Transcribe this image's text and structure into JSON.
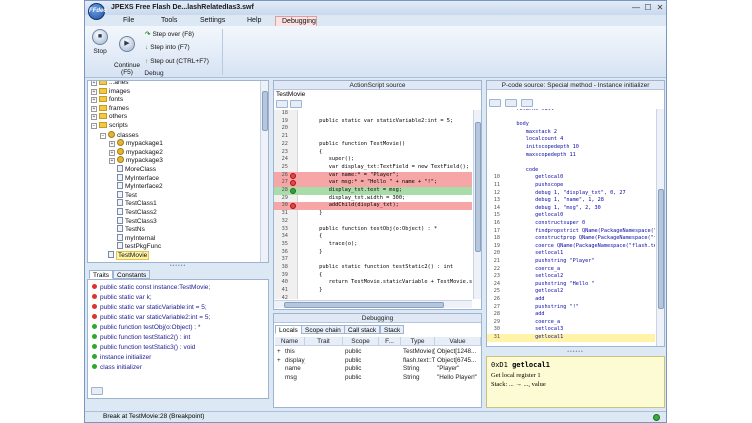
{
  "window": {
    "logo": "FFdec",
    "title": "JPEXS Free Flash De...lashRelatedIas3.swf",
    "controls": {
      "minimize": "—",
      "maximize": "☐",
      "close": "✕"
    }
  },
  "menu": [
    "File",
    "Tools",
    "Settings",
    "Help",
    "Debugging"
  ],
  "ribbon": {
    "stop_label": "Stop",
    "continue_label": "Continue\n(F5)",
    "step_over": "Step over (F8)",
    "step_into": "Step into (F7)",
    "step_out": "Step out (CTRL+F7)",
    "group_label": "Debug"
  },
  "tree": {
    "items": [
      {
        "label": "...aries",
        "indent": 0,
        "kind": "folder",
        "expander": "+"
      },
      {
        "label": "images",
        "indent": 0,
        "kind": "folder",
        "expander": "+"
      },
      {
        "label": "fonts",
        "indent": 0,
        "kind": "folder",
        "expander": "+"
      },
      {
        "label": "frames",
        "indent": 0,
        "kind": "folder",
        "expander": "+"
      },
      {
        "label": "others",
        "indent": 0,
        "kind": "folder",
        "expander": "+"
      },
      {
        "label": "scripts",
        "indent": 0,
        "kind": "folder",
        "expander": "−"
      },
      {
        "label": "classes",
        "indent": 1,
        "kind": "package",
        "expander": "−"
      },
      {
        "label": "mypackage1",
        "indent": 2,
        "kind": "package",
        "expander": "+"
      },
      {
        "label": "mypackage2",
        "indent": 2,
        "kind": "package",
        "expander": "+"
      },
      {
        "label": "mypackage3",
        "indent": 2,
        "kind": "package",
        "expander": "+"
      },
      {
        "label": "MoreClass",
        "indent": 2,
        "kind": "class",
        "expander": ""
      },
      {
        "label": "MyInterface",
        "indent": 2,
        "kind": "class",
        "expander": ""
      },
      {
        "label": "MyInterface2",
        "indent": 2,
        "kind": "class",
        "expander": ""
      },
      {
        "label": "Test",
        "indent": 2,
        "kind": "class",
        "expander": ""
      },
      {
        "label": "TestClass1",
        "indent": 2,
        "kind": "class",
        "expander": ""
      },
      {
        "label": "TestClass2",
        "indent": 2,
        "kind": "class",
        "expander": ""
      },
      {
        "label": "TestClass3",
        "indent": 2,
        "kind": "class",
        "expander": ""
      },
      {
        "label": "TestNs",
        "indent": 2,
        "kind": "class",
        "expander": ""
      },
      {
        "label": "myInternal",
        "indent": 2,
        "kind": "class",
        "expander": ""
      },
      {
        "label": "testPkgFunc",
        "indent": 2,
        "kind": "class",
        "expander": ""
      },
      {
        "label": "TestMovie",
        "indent": 1,
        "kind": "class",
        "expander": "",
        "selected": true
      }
    ]
  },
  "traits_tabs": [
    "Traits",
    "Constants"
  ],
  "traits": [
    {
      "text": "public static const instance:TestMovie;",
      "color": "#e03030"
    },
    {
      "text": "public static var k;",
      "color": "#e03030"
    },
    {
      "text": "public static var staticVariable:int = 5;",
      "color": "#e03030"
    },
    {
      "text": "public static var staticVariable2:int = 5;",
      "color": "#e03030"
    },
    {
      "text": "public function testObj(o:Object) : *",
      "color": "#2ea82e"
    },
    {
      "text": "public function testStatic2() : int",
      "color": "#2ea82e"
    },
    {
      "text": "public function testStatic3() : void",
      "color": "#2ea82e"
    },
    {
      "text": "instance initializer",
      "color": "#2ea82e"
    },
    {
      "text": "class initializer",
      "color": "#2ea82e"
    }
  ],
  "as_panel": {
    "header": "ActionScript source",
    "file_label": "TestMovie",
    "lines": [
      {
        "n": "18",
        "text": "",
        "mark": ""
      },
      {
        "n": "19",
        "text": "      public static var staticVariable2:int = 5;",
        "mark": ""
      },
      {
        "n": "20",
        "text": "",
        "mark": ""
      },
      {
        "n": "21",
        "text": "",
        "mark": ""
      },
      {
        "n": "22",
        "text": "      public function TestMovie()",
        "mark": ""
      },
      {
        "n": "23",
        "text": "      {",
        "mark": ""
      },
      {
        "n": "24",
        "text": "         super();",
        "mark": ""
      },
      {
        "n": "25",
        "text": "         var display_txt:TextField = new TextField();",
        "mark": ""
      },
      {
        "n": "26",
        "text": "         var name:* = \"Player\";",
        "mark": "bp"
      },
      {
        "n": "27",
        "text": "         var msg:* = \"Hello \" + name + \"!\";",
        "mark": "bp"
      },
      {
        "n": "28",
        "text": "         display_txt.text = msg;",
        "mark": "cur"
      },
      {
        "n": "29",
        "text": "         display_txt.width = 300;",
        "mark": ""
      },
      {
        "n": "30",
        "text": "         addChild(display_txt);",
        "mark": "bp"
      },
      {
        "n": "31",
        "text": "      }",
        "mark": ""
      },
      {
        "n": "32",
        "text": "",
        "mark": ""
      },
      {
        "n": "33",
        "text": "      public function testObj(o:Object) : *",
        "mark": ""
      },
      {
        "n": "34",
        "text": "      {",
        "mark": ""
      },
      {
        "n": "35",
        "text": "         trace(o);",
        "mark": ""
      },
      {
        "n": "36",
        "text": "      }",
        "mark": ""
      },
      {
        "n": "37",
        "text": "",
        "mark": ""
      },
      {
        "n": "38",
        "text": "      public static function testStatic2() : int",
        "mark": ""
      },
      {
        "n": "39",
        "text": "      {",
        "mark": ""
      },
      {
        "n": "40",
        "text": "         return TestMovie.staticVariable + TestMovie.static",
        "mark": ""
      },
      {
        "n": "41",
        "text": "      }",
        "mark": ""
      },
      {
        "n": "42",
        "text": "",
        "mark": ""
      }
    ]
  },
  "pcode_panel": {
    "header": "P-code source: Special method - Instance initializer",
    "lines": [
      {
        "n": "",
        "text": "   returns null"
      },
      {
        "n": "",
        "text": ""
      },
      {
        "n": "",
        "text": "   body"
      },
      {
        "n": "",
        "text": "      maxstack 2"
      },
      {
        "n": "",
        "text": "      localcount 4"
      },
      {
        "n": "",
        "text": "      initscopedepth 10"
      },
      {
        "n": "",
        "text": "      maxscopedepth 11"
      },
      {
        "n": "",
        "text": ""
      },
      {
        "n": "",
        "text": "      code"
      },
      {
        "n": "10",
        "text": "         getlocal0"
      },
      {
        "n": "11",
        "text": "         pushscope"
      },
      {
        "n": "12",
        "text": "         debug 1, \"display_txt\", 0, 27"
      },
      {
        "n": "13",
        "text": "         debug 1, \"name\", 1, 28"
      },
      {
        "n": "14",
        "text": "         debug 1, \"msg\", 2, 30"
      },
      {
        "n": "15",
        "text": "         getlocal0"
      },
      {
        "n": "16",
        "text": "         constructsuper 0"
      },
      {
        "n": "17",
        "text": "         findpropstrict QName(PackageNamespace(\"f"
      },
      {
        "n": "18",
        "text": "         constructprop QName(PackageNamespace(\"fl"
      },
      {
        "n": "19",
        "text": "         coerce QName(PackageNamespace(\"flash.text"
      },
      {
        "n": "20",
        "text": "         setlocal1"
      },
      {
        "n": "21",
        "text": "         pushstring \"Player\""
      },
      {
        "n": "22",
        "text": "         coerce_a"
      },
      {
        "n": "23",
        "text": "         setlocal2"
      },
      {
        "n": "24",
        "text": "         pushstring \"Hello \""
      },
      {
        "n": "25",
        "text": "         getlocal2"
      },
      {
        "n": "26",
        "text": "         add"
      },
      {
        "n": "27",
        "text": "         pushstring \"!\""
      },
      {
        "n": "28",
        "text": "         add"
      },
      {
        "n": "29",
        "text": "         coerce_a"
      },
      {
        "n": "30",
        "text": "         setlocal3"
      },
      {
        "n": "31",
        "text": "         getlocal1"
      }
    ]
  },
  "instruction_info": {
    "opcode": "0xD1",
    "name": "getlocal1",
    "description": "Get local register 1",
    "stack": "Stack: ... → ..., value"
  },
  "debug_panel": {
    "header": "Debugging",
    "tabs": [
      "Locals",
      "Scope chain",
      "Call stack",
      "Stack"
    ],
    "columns": [
      "Name",
      "Trait",
      "Scope",
      "F...",
      "Type",
      "Value"
    ],
    "rows": [
      {
        "expander": "+",
        "name": "this",
        "trait": "",
        "scope": "public",
        "f": "",
        "type": "TestMovie@...",
        "value": "Object[1248..."
      },
      {
        "expander": "+",
        "name": "display_",
        "trait": "",
        "scope": "public",
        "f": "",
        "type": "flash.text::T...",
        "value": "Object[6745..."
      },
      {
        "expander": "",
        "name": "name",
        "trait": "",
        "scope": "public",
        "f": "",
        "type": "String",
        "value": "\"Player\""
      },
      {
        "expander": "",
        "name": "msg",
        "trait": "",
        "scope": "public",
        "f": "",
        "type": "String",
        "value": "\"Hello Player!\""
      }
    ]
  },
  "status": {
    "text": "Break at TestMovie:28 (Breakpoint)"
  },
  "colors": {
    "breakpoint_bg": "#f6a6a6",
    "current_line_bg": "#a8dca8",
    "selection": "#fff3a8"
  }
}
